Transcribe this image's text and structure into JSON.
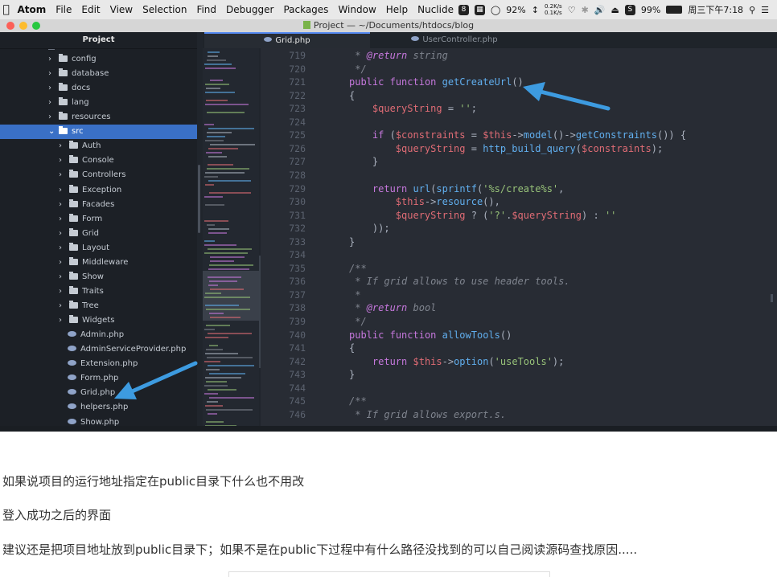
{
  "menubar": {
    "app": "Atom",
    "items": [
      "File",
      "Edit",
      "View",
      "Selection",
      "Find",
      "Debugger",
      "Packages",
      "Window",
      "Help",
      "Nuclide"
    ],
    "cpu": "92%",
    "net_up": "0.2K/s",
    "net_down": "0.1K/s",
    "battery": "99%",
    "clock": "周三下午7:18"
  },
  "window": {
    "title": "Project — ~/Documents/htdocs/blog"
  },
  "sidebar": {
    "title": "Project",
    "items": [
      {
        "label": "config",
        "type": "folder",
        "level": 1
      },
      {
        "label": "database",
        "type": "folder",
        "level": 1
      },
      {
        "label": "docs",
        "type": "folder",
        "level": 1
      },
      {
        "label": "lang",
        "type": "folder",
        "level": 1
      },
      {
        "label": "resources",
        "type": "folder",
        "level": 1
      },
      {
        "label": "src",
        "type": "folder",
        "level": 1,
        "open": true,
        "selected": true
      },
      {
        "label": "Auth",
        "type": "folder",
        "level": 2
      },
      {
        "label": "Console",
        "type": "folder",
        "level": 2
      },
      {
        "label": "Controllers",
        "type": "folder",
        "level": 2
      },
      {
        "label": "Exception",
        "type": "folder",
        "level": 2
      },
      {
        "label": "Facades",
        "type": "folder",
        "level": 2
      },
      {
        "label": "Form",
        "type": "folder",
        "level": 2
      },
      {
        "label": "Grid",
        "type": "folder",
        "level": 2
      },
      {
        "label": "Layout",
        "type": "folder",
        "level": 2
      },
      {
        "label": "Middleware",
        "type": "folder",
        "level": 2
      },
      {
        "label": "Show",
        "type": "folder",
        "level": 2
      },
      {
        "label": "Traits",
        "type": "folder",
        "level": 2
      },
      {
        "label": "Tree",
        "type": "folder",
        "level": 2
      },
      {
        "label": "Widgets",
        "type": "folder",
        "level": 2
      },
      {
        "label": "Admin.php",
        "type": "file",
        "level": 2
      },
      {
        "label": "AdminServiceProvider.php",
        "type": "file",
        "level": 2
      },
      {
        "label": "Extension.php",
        "type": "file",
        "level": 2
      },
      {
        "label": "Form.php",
        "type": "file",
        "level": 2
      },
      {
        "label": "Grid.php",
        "type": "file",
        "level": 2
      },
      {
        "label": "helpers.php",
        "type": "file",
        "level": 2
      },
      {
        "label": "Show.php",
        "type": "file",
        "level": 2
      }
    ]
  },
  "tabs": [
    {
      "label": "Grid.php",
      "active": true
    },
    {
      "label": "UserController.php",
      "active": false
    }
  ],
  "editor": {
    "lines": [
      {
        "n": "719",
        "parts": [
          [
            "com",
            " * "
          ],
          [
            "tag",
            "@return"
          ],
          [
            "com",
            " string"
          ]
        ]
      },
      {
        "n": "720",
        "parts": [
          [
            "com",
            " */"
          ]
        ]
      },
      {
        "n": "721",
        "parts": [
          [
            "kw",
            "public"
          ],
          [
            "txt",
            " "
          ],
          [
            "kw",
            "function"
          ],
          [
            "txt",
            " "
          ],
          [
            "fn",
            "getCreateUrl"
          ],
          [
            "txt",
            "()"
          ]
        ]
      },
      {
        "n": "722",
        "parts": [
          [
            "txt",
            "{"
          ]
        ]
      },
      {
        "n": "723",
        "parts": [
          [
            "txt",
            "    "
          ],
          [
            "var",
            "$queryString"
          ],
          [
            "txt",
            " = "
          ],
          [
            "str",
            "''"
          ],
          [
            "txt",
            ";"
          ]
        ]
      },
      {
        "n": "724",
        "parts": []
      },
      {
        "n": "725",
        "parts": [
          [
            "txt",
            "    "
          ],
          [
            "kw",
            "if"
          ],
          [
            "txt",
            " ("
          ],
          [
            "var",
            "$constraints"
          ],
          [
            "txt",
            " = "
          ],
          [
            "var",
            "$this"
          ],
          [
            "txt",
            "->"
          ],
          [
            "fn",
            "model"
          ],
          [
            "txt",
            "()->"
          ],
          [
            "fn",
            "getConstraints"
          ],
          [
            "txt",
            "()) {"
          ]
        ]
      },
      {
        "n": "726",
        "parts": [
          [
            "txt",
            "        "
          ],
          [
            "var",
            "$queryString"
          ],
          [
            "txt",
            " = "
          ],
          [
            "fn",
            "http_build_query"
          ],
          [
            "txt",
            "("
          ],
          [
            "var",
            "$constraints"
          ],
          [
            "txt",
            ");"
          ]
        ]
      },
      {
        "n": "727",
        "parts": [
          [
            "txt",
            "    }"
          ]
        ]
      },
      {
        "n": "728",
        "parts": []
      },
      {
        "n": "729",
        "parts": [
          [
            "txt",
            "    "
          ],
          [
            "kw",
            "return"
          ],
          [
            "txt",
            " "
          ],
          [
            "fn",
            "url"
          ],
          [
            "txt",
            "("
          ],
          [
            "fn",
            "sprintf"
          ],
          [
            "txt",
            "("
          ],
          [
            "str",
            "'%s/create%s'"
          ],
          [
            "txt",
            ","
          ]
        ]
      },
      {
        "n": "730",
        "parts": [
          [
            "txt",
            "        "
          ],
          [
            "var",
            "$this"
          ],
          [
            "txt",
            "->"
          ],
          [
            "fn",
            "resource"
          ],
          [
            "txt",
            "(),"
          ]
        ]
      },
      {
        "n": "731",
        "parts": [
          [
            "txt",
            "        "
          ],
          [
            "var",
            "$queryString"
          ],
          [
            "txt",
            " ? ("
          ],
          [
            "str",
            "'?'"
          ],
          [
            "txt",
            "."
          ],
          [
            "var",
            "$queryString"
          ],
          [
            "txt",
            ") : "
          ],
          [
            "str",
            "''"
          ]
        ]
      },
      {
        "n": "732",
        "parts": [
          [
            "txt",
            "    ));"
          ]
        ]
      },
      {
        "n": "733",
        "parts": [
          [
            "txt",
            "}"
          ]
        ]
      },
      {
        "n": "734",
        "parts": []
      },
      {
        "n": "735",
        "parts": [
          [
            "com",
            "/**"
          ]
        ]
      },
      {
        "n": "736",
        "parts": [
          [
            "com",
            " * If grid allows to use header tools."
          ]
        ]
      },
      {
        "n": "737",
        "parts": [
          [
            "com",
            " *"
          ]
        ]
      },
      {
        "n": "738",
        "parts": [
          [
            "com",
            " * "
          ],
          [
            "tag",
            "@return"
          ],
          [
            "com",
            " bool"
          ]
        ]
      },
      {
        "n": "739",
        "parts": [
          [
            "com",
            " */"
          ]
        ]
      },
      {
        "n": "740",
        "parts": [
          [
            "kw",
            "public"
          ],
          [
            "txt",
            " "
          ],
          [
            "kw",
            "function"
          ],
          [
            "txt",
            " "
          ],
          [
            "fn",
            "allowTools"
          ],
          [
            "txt",
            "()"
          ]
        ]
      },
      {
        "n": "741",
        "parts": [
          [
            "txt",
            "{"
          ]
        ]
      },
      {
        "n": "742",
        "parts": [
          [
            "txt",
            "    "
          ],
          [
            "kw",
            "return"
          ],
          [
            "txt",
            " "
          ],
          [
            "var",
            "$this"
          ],
          [
            "txt",
            "->"
          ],
          [
            "fn",
            "option"
          ],
          [
            "txt",
            "("
          ],
          [
            "str",
            "'useTools'"
          ],
          [
            "txt",
            ");"
          ]
        ]
      },
      {
        "n": "743",
        "parts": [
          [
            "txt",
            "}"
          ]
        ]
      },
      {
        "n": "744",
        "parts": []
      },
      {
        "n": "745",
        "parts": [
          [
            "com",
            "/**"
          ]
        ]
      },
      {
        "n": "746",
        "parts": [
          [
            "com",
            " * If grid allows export.s."
          ]
        ]
      }
    ]
  },
  "article": {
    "p1": "如果说项目的运行地址指定在public目录下什么也不用改",
    "p2": "登入成功之后的界面",
    "p3": "建议还是把项目地址放到public目录下；如果不是在public下过程中有什么路径没找到的可以自己阅读源码查找原因....."
  },
  "colors": {
    "selection": "#3a70c6",
    "arrow": "#3d9be0",
    "editor_bg": "#282c34"
  }
}
